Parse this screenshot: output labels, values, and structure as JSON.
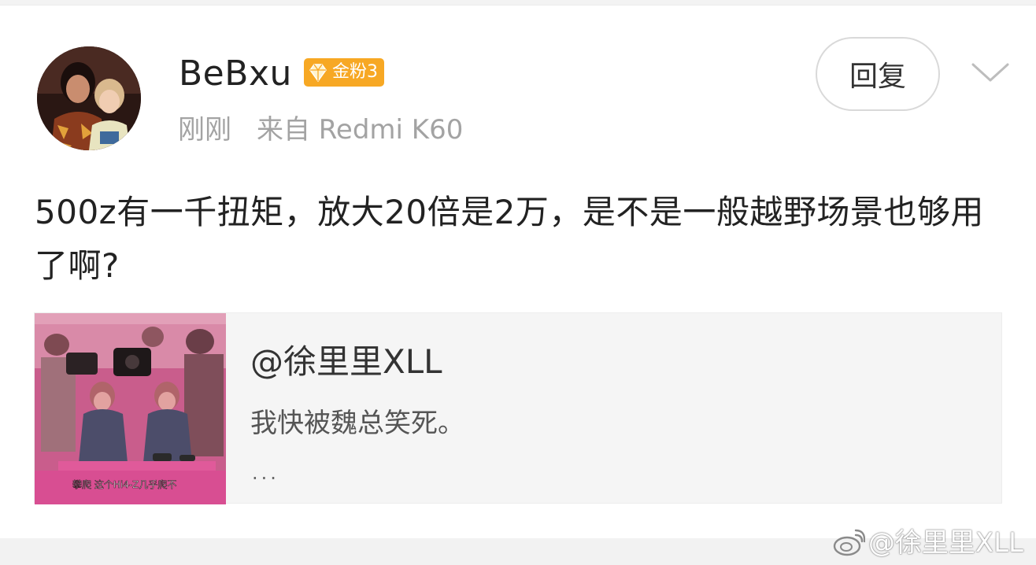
{
  "post": {
    "username": "BeBxu",
    "badge_label": "金粉3",
    "time": "刚刚",
    "source": "来自 Redmi K60",
    "reply_label": "回复",
    "text": "500z有一千扭矩，放大20倍是2万，是不是一般越野场景也够用了啊?"
  },
  "quote": {
    "author": "@徐里里XLL",
    "text": "我快被魏总笑死。",
    "more": "...",
    "thumb_caption": "攀爬 这个Hi4-Z几乎爬不"
  },
  "watermark": {
    "text": "@徐里里XLL"
  },
  "colors": {
    "badge": "#f7a824",
    "meta_text": "#a3a3a3",
    "card_bg": "#f5f5f5"
  },
  "icons": {
    "badge": "diamond-icon",
    "more": "chevron-down-icon",
    "watermark": "weibo-logo-icon"
  }
}
